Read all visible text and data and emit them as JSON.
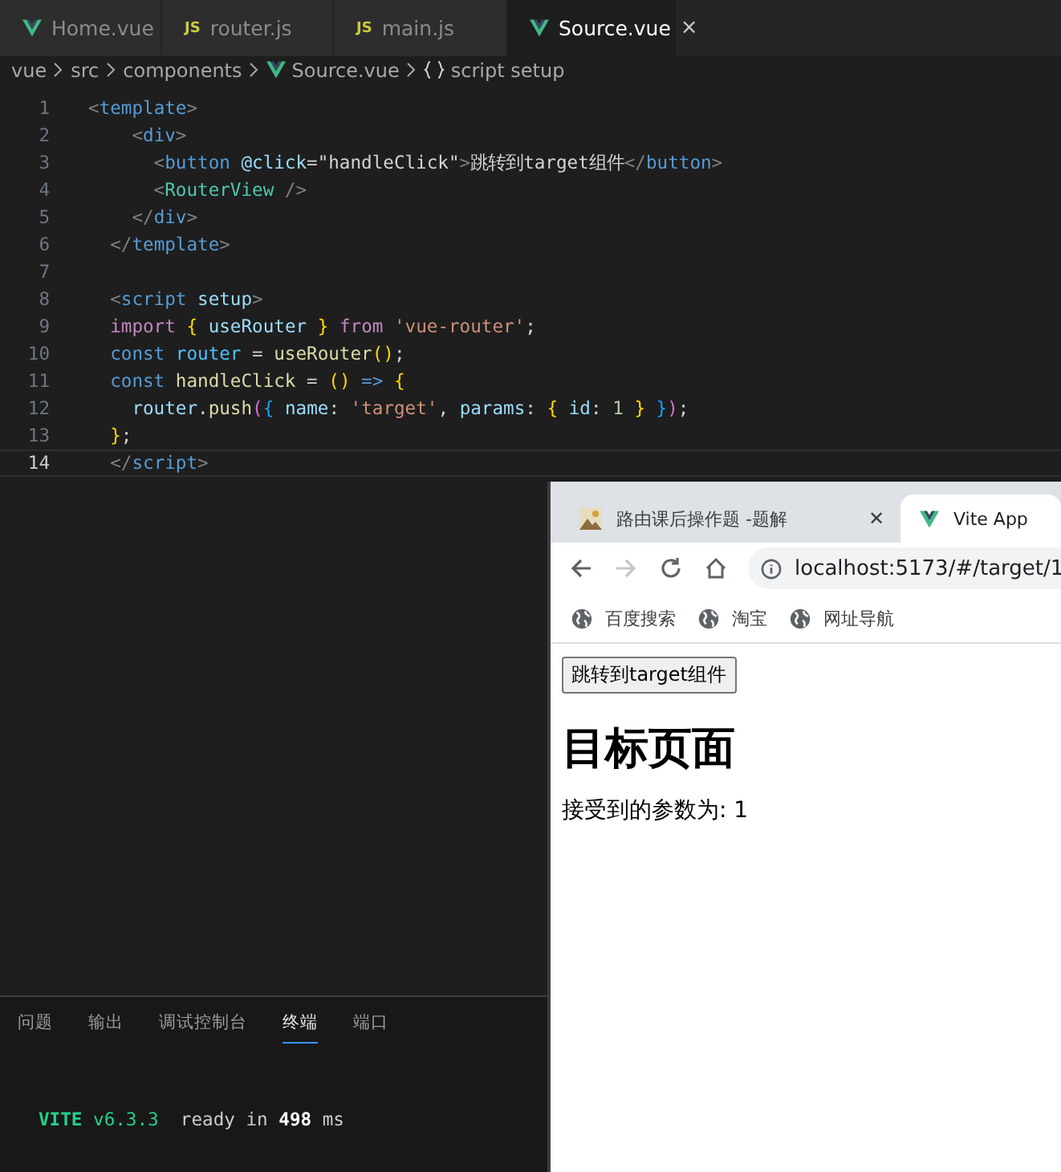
{
  "editor": {
    "tabs": [
      {
        "label": "Home.vue",
        "kind": "vue",
        "selected": false
      },
      {
        "label": "router.js",
        "kind": "js",
        "badge": "JS",
        "selected": false
      },
      {
        "label": "main.js",
        "kind": "js",
        "badge": "JS",
        "selected": false
      },
      {
        "label": "Source.vue",
        "kind": "vue",
        "selected": true,
        "close": "×"
      }
    ],
    "breadcrumb": [
      {
        "label": "vue",
        "kind": "plain"
      },
      {
        "label": "src",
        "kind": "plain"
      },
      {
        "label": "components",
        "kind": "plain"
      },
      {
        "label": "Source.vue",
        "kind": "vue"
      },
      {
        "label": "script setup",
        "kind": "symbol"
      }
    ],
    "lines": [
      {
        "number": "1",
        "current": false,
        "tokens": [
          {
            "t": "<",
            "kind": "p"
          },
          {
            "t": "template",
            "kind": "tag"
          },
          {
            "t": ">",
            "kind": "p"
          }
        ]
      },
      {
        "number": "2",
        "current": false,
        "tokens": [
          {
            "t": "    <",
            "kind": "p"
          },
          {
            "t": "div",
            "kind": "tag"
          },
          {
            "t": ">",
            "kind": "p"
          }
        ]
      },
      {
        "number": "3",
        "current": false,
        "tokens": [
          {
            "t": "      <",
            "kind": "p"
          },
          {
            "t": "button",
            "kind": "tag"
          },
          {
            "t": " @click",
            "kind": "attr"
          },
          {
            "t": "=\"handleClick\"",
            "kind": "text"
          },
          {
            "t": ">",
            "kind": "p"
          },
          {
            "t": "跳转到target组件",
            "kind": "text"
          },
          {
            "t": "</",
            "kind": "p"
          },
          {
            "t": "button",
            "kind": "tag"
          },
          {
            "t": ">",
            "kind": "p"
          }
        ]
      },
      {
        "number": "4",
        "current": false,
        "tokens": [
          {
            "t": "      <",
            "kind": "p"
          },
          {
            "t": "RouterView",
            "kind": "comp"
          },
          {
            "t": " />",
            "kind": "p"
          }
        ]
      },
      {
        "number": "5",
        "current": false,
        "tokens": [
          {
            "t": "    </",
            "kind": "p"
          },
          {
            "t": "div",
            "kind": "tag"
          },
          {
            "t": ">",
            "kind": "p"
          }
        ]
      },
      {
        "number": "6",
        "current": false,
        "tokens": [
          {
            "t": "  </",
            "kind": "p"
          },
          {
            "t": "template",
            "kind": "tag"
          },
          {
            "t": ">",
            "kind": "p"
          }
        ]
      },
      {
        "number": "7",
        "current": false
      },
      {
        "number": "8",
        "current": false,
        "tokens": [
          {
            "t": "  <",
            "kind": "p"
          },
          {
            "t": "script",
            "kind": "tag"
          },
          {
            "t": " setup",
            "kind": "attr"
          },
          {
            "t": ">",
            "kind": "p"
          }
        ]
      },
      {
        "number": "9",
        "current": false,
        "tokens": [
          {
            "t": "  import",
            "kind": "kw"
          },
          {
            "t": " {",
            "kind": "br1"
          },
          {
            "t": " useRouter ",
            "kind": "var"
          },
          {
            "t": "}",
            "kind": "br1"
          },
          {
            "t": " from",
            "kind": "kw"
          },
          {
            "t": " 'vue-router'",
            "kind": "str"
          },
          {
            "t": ";",
            "kind": "text"
          }
        ]
      },
      {
        "number": "10",
        "current": false,
        "tokens": [
          {
            "t": "  const",
            "kind": "stor"
          },
          {
            "t": " router",
            "kind": "const"
          },
          {
            "t": " = ",
            "kind": "text"
          },
          {
            "t": "useRouter",
            "kind": "fn"
          },
          {
            "t": "()",
            "kind": "br1"
          },
          {
            "t": ";",
            "kind": "text"
          }
        ]
      },
      {
        "number": "11",
        "current": false,
        "tokens": [
          {
            "t": "  const",
            "kind": "stor"
          },
          {
            "t": " handleClick",
            "kind": "fn"
          },
          {
            "t": " = ",
            "kind": "text"
          },
          {
            "t": "()",
            "kind": "br1"
          },
          {
            "t": " => ",
            "kind": "stor"
          },
          {
            "t": "{",
            "kind": "br1"
          }
        ]
      },
      {
        "number": "12",
        "current": false,
        "tokens": [
          {
            "t": "    router",
            "kind": "var"
          },
          {
            "t": ".",
            "kind": "text"
          },
          {
            "t": "push",
            "kind": "fn"
          },
          {
            "t": "(",
            "kind": "br2"
          },
          {
            "t": "{",
            "kind": "br3"
          },
          {
            "t": " name",
            "kind": "var"
          },
          {
            "t": ": ",
            "kind": "text"
          },
          {
            "t": "'target'",
            "kind": "str"
          },
          {
            "t": ", ",
            "kind": "text"
          },
          {
            "t": "params",
            "kind": "var"
          },
          {
            "t": ": ",
            "kind": "text"
          },
          {
            "t": "{",
            "kind": "br1"
          },
          {
            "t": " id",
            "kind": "var"
          },
          {
            "t": ": ",
            "kind": "text"
          },
          {
            "t": "1",
            "kind": "num"
          },
          {
            "t": " }",
            "kind": "br1"
          },
          {
            "t": " }",
            "kind": "br3"
          },
          {
            "t": ")",
            "kind": "br2"
          },
          {
            "t": ";",
            "kind": "text"
          }
        ]
      },
      {
        "number": "13",
        "current": false,
        "tokens": [
          {
            "t": "  }",
            "kind": "br1"
          },
          {
            "t": ";",
            "kind": "text"
          }
        ]
      },
      {
        "number": "14",
        "current": true,
        "tokens": [
          {
            "t": "  </",
            "kind": "p"
          },
          {
            "t": "script",
            "kind": "tag"
          },
          {
            "t": ">",
            "kind": "p"
          }
        ]
      }
    ]
  },
  "panel": {
    "tabs": [
      {
        "label": "问题",
        "selected": false
      },
      {
        "label": "输出",
        "selected": false
      },
      {
        "label": "调试控制台",
        "selected": false
      },
      {
        "label": "终端",
        "selected": true
      },
      {
        "label": "端口",
        "selected": false
      }
    ],
    "terminal": [
      {
        "t": "VITE",
        "kind": "brand"
      },
      {
        "t": " v6.3.3",
        "kind": "ver"
      },
      {
        "t": "  ready in ",
        "kind": "dim"
      },
      {
        "t": "498",
        "kind": "bold"
      },
      {
        "t": " ms",
        "kind": "dim"
      }
    ]
  },
  "browser": {
    "tabs": [
      {
        "label": "路由课后操作题 -题解",
        "kind": "picture",
        "selected": false,
        "close": "✕"
      },
      {
        "label": "Vite App",
        "kind": "vue",
        "selected": true
      }
    ],
    "url": "localhost:5173/#/target/1",
    "forward_disabled": true,
    "bookmarks": [
      "百度搜索",
      "淘宝",
      "网址导航"
    ],
    "page": {
      "button": "跳转到target组件",
      "heading": "目标页面",
      "text": "接受到的参数为: 1"
    }
  }
}
